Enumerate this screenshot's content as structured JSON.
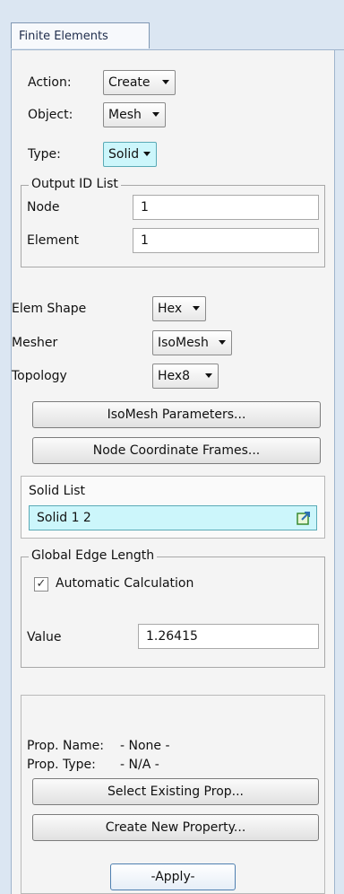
{
  "tab": {
    "label": "Finite Elements"
  },
  "form": {
    "action": {
      "label": "Action:",
      "value": "Create"
    },
    "object": {
      "label": "Object:",
      "value": "Mesh"
    },
    "type": {
      "label": "Type:",
      "value": "Solid"
    }
  },
  "output_id": {
    "legend": "Output ID List",
    "node_label": "Node",
    "node_value": "1",
    "element_label": "Element",
    "element_value": "1"
  },
  "elem": {
    "shape_label": "Elem Shape",
    "shape_value": "Hex",
    "mesher_label": "Mesher",
    "mesher_value": "IsoMesh",
    "topology_label": "Topology",
    "topology_value": "Hex8"
  },
  "buttons": {
    "isomesh_params": "IsoMesh Parameters...",
    "node_coord_frames": "Node Coordinate Frames...",
    "select_existing_prop": "Select Existing Prop...",
    "create_new_property": "Create New Property...",
    "apply": "-Apply-"
  },
  "solid_list": {
    "label": "Solid List",
    "value": "Solid 1 2",
    "icon": "select-list-icon"
  },
  "global_edge": {
    "legend": "Global Edge Length",
    "auto_label": "Automatic Calculation",
    "auto_checked": true,
    "value_label": "Value",
    "value": "1.26415"
  },
  "prop": {
    "name_label": "Prop. Name:",
    "name_value": "- None -",
    "type_label": "Prop. Type:",
    "type_value": "- N/A -"
  },
  "colors": {
    "active_field": "#ccf6fb",
    "panel_bg": "#f4f4f4",
    "frame_bg": "#dbe6f2"
  }
}
